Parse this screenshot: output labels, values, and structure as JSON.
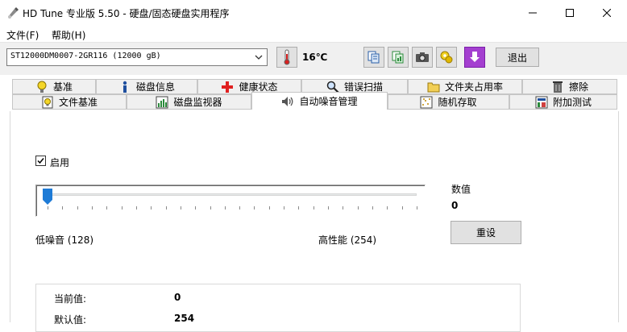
{
  "window": {
    "title": "HD Tune 专业版 5.50 - 硬盘/固态硬盘实用程序",
    "icons": [
      "hdtune-app-icon",
      "minimize-icon",
      "maximize-icon",
      "close-icon"
    ]
  },
  "menu": {
    "items": [
      {
        "label": "文件(F)"
      },
      {
        "label": "帮助(H)"
      }
    ]
  },
  "toolbar": {
    "drive_selected": "ST12000DM0007-2GR116 (12000 gB)",
    "temperature": "16℃",
    "exit_label": "退出",
    "tool_icons": [
      "copy-text-icon",
      "copy-info-icon",
      "screenshot-camera-icon",
      "options-icon",
      "save-download-icon"
    ]
  },
  "tabs": {
    "row1": [
      {
        "label": "基准",
        "icon": "lightbulb-icon"
      },
      {
        "label": "磁盘信息",
        "icon": "info-icon"
      },
      {
        "label": "健康状态",
        "icon": "health-cross-icon"
      },
      {
        "label": "错误扫描",
        "icon": "magnifier-icon"
      },
      {
        "label": "文件夹占用率",
        "icon": "folder-icon"
      },
      {
        "label": "擦除",
        "icon": "trash-icon"
      }
    ],
    "row2": [
      {
        "label": "文件基准",
        "icon": "file-lightbulb-icon"
      },
      {
        "label": "磁盘监视器",
        "icon": "bar-chart-icon"
      },
      {
        "label": "自动噪音管理",
        "icon": "speaker-icon",
        "active": true
      },
      {
        "label": "随机存取",
        "icon": "scatter-icon"
      },
      {
        "label": "附加测试",
        "icon": "extra-test-icon"
      }
    ]
  },
  "aam": {
    "enable_label": "启用",
    "enabled": true,
    "slider_value": 0,
    "low_label": "低噪音 (128)",
    "high_label": "高性能 (254)",
    "value_title": "数值",
    "value": "0",
    "reset_label": "重设",
    "info": {
      "current_label": "当前值:",
      "current_value": "0",
      "default_label": "默认值:",
      "default_value": "254"
    }
  },
  "colors": {
    "toolbar_bg": "#f0f0f0",
    "button_bg": "#e1e1e1",
    "slider_thumb": "#1e7bd6",
    "health_red": "#e02020"
  }
}
